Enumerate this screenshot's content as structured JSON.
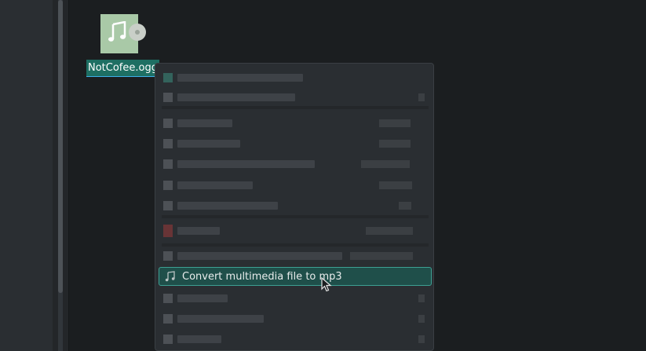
{
  "desktop": {
    "file": {
      "name": "NotCofee.ogg",
      "icon": "audio-file-icon"
    }
  },
  "context_menu": {
    "highlighted_item": {
      "label": "Convert multimedia file to mp3",
      "icon": "music-note-icon"
    }
  },
  "colors": {
    "selection": "#1e6f63",
    "highlight_bg": "#1f4f4a",
    "highlight_border": "#3da093",
    "menu_bg": "#2a2e32"
  }
}
